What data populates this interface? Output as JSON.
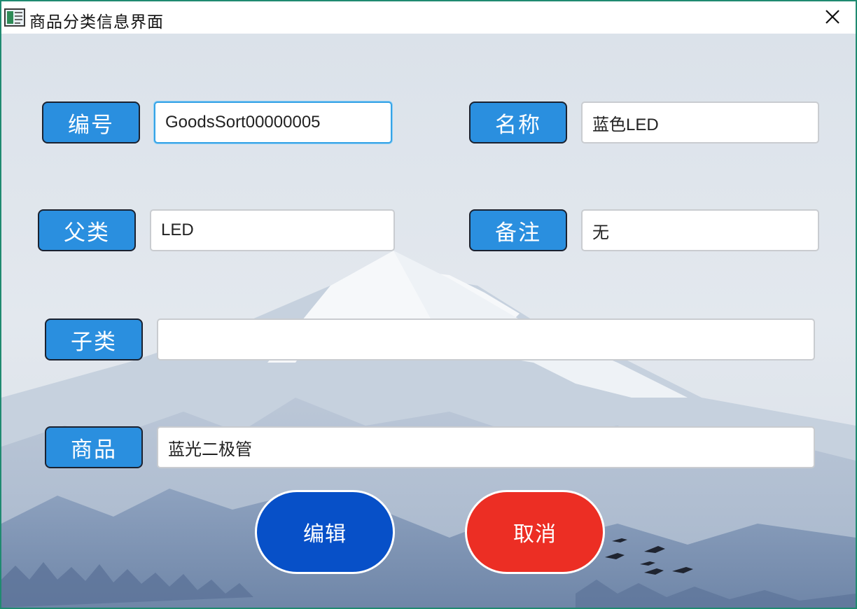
{
  "window": {
    "title": "商品分类信息界面",
    "app_icon": "form-window-icon",
    "close_icon": "close-icon"
  },
  "form": {
    "id": {
      "label": "编号",
      "value": "GoodsSort00000005"
    },
    "name": {
      "label": "名称",
      "value": "蓝色LED"
    },
    "parent": {
      "label": "父类",
      "value": "LED"
    },
    "remark": {
      "label": "备注",
      "value": "无"
    },
    "children": {
      "label": "子类",
      "value": ""
    },
    "goods": {
      "label": "商品",
      "value": "蓝光二极管"
    }
  },
  "buttons": {
    "edit": "编辑",
    "cancel": "取消"
  },
  "colors": {
    "label_bg": "#2a8fdf",
    "edit_bg": "#0750c8",
    "cancel_bg": "#ec2e24",
    "window_border": "#1f8a70"
  }
}
